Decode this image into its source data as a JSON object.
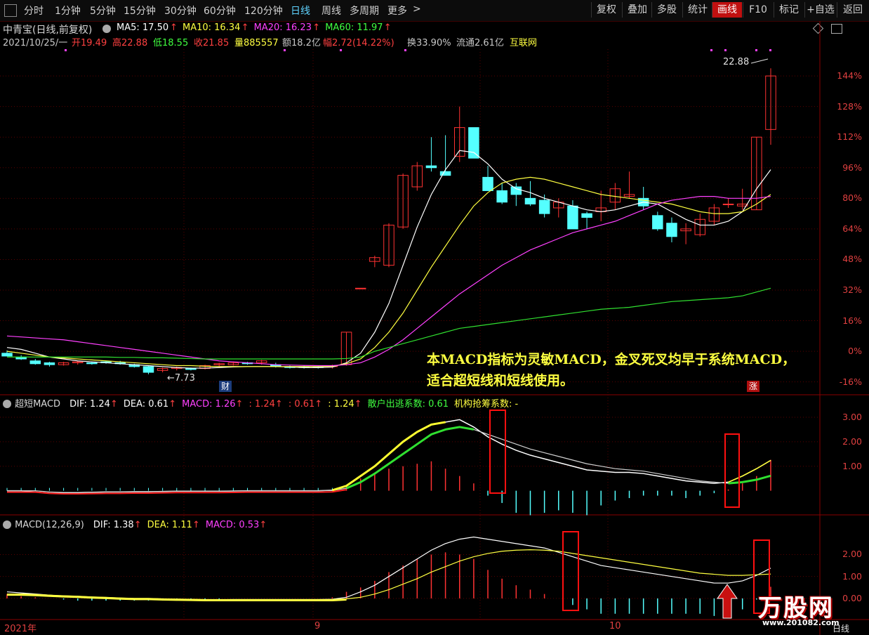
{
  "toolbar": {
    "periods": [
      "分时",
      "1分钟",
      "5分钟",
      "15分钟",
      "30分钟",
      "60分钟",
      "120分钟",
      "日线",
      "周线",
      "多周期",
      "更多"
    ],
    "active_period": "日线",
    "right_buttons": [
      "复权",
      "叠加",
      "多股",
      "统计",
      "画线",
      "F10",
      "标记",
      "+自选",
      "返回"
    ],
    "active_button": "画线"
  },
  "header": {
    "title": "中青宝(日线,前复权)",
    "ma": [
      {
        "label": "MA5: 17.50",
        "color": "#ffffff"
      },
      {
        "label": "MA10: 16.34",
        "color": "#ffff40"
      },
      {
        "label": "MA20: 16.23",
        "color": "#ff40ff"
      },
      {
        "label": "MA60: 11.97",
        "color": "#40ff40"
      }
    ],
    "info": [
      {
        "text": "2021/10/25/一",
        "color": "#c8c8c8"
      },
      {
        "text": "开19.49",
        "color": "#ff4040"
      },
      {
        "text": "高22.88",
        "color": "#ff4040"
      },
      {
        "text": "低18.55",
        "color": "#40ff40"
      },
      {
        "text": "收21.85",
        "color": "#ff4040"
      },
      {
        "text": "量885557",
        "color": "#ffff40"
      },
      {
        "text": "额18.2亿",
        "color": "#c8c8c8"
      },
      {
        "text": "幅2.72(14.22%)",
        "color": "#ff4040"
      },
      {
        "text": "换33.90%",
        "color": "#c8c8c8"
      },
      {
        "text": "流通2.61亿",
        "color": "#c8c8c8"
      },
      {
        "text": "互联网",
        "color": "#ffff40"
      }
    ]
  },
  "price_axis": [
    "144%",
    "128%",
    "112%",
    "96%",
    "80%",
    "64%",
    "48%",
    "32%",
    "16%",
    "0%",
    "-16%"
  ],
  "annotations": {
    "high_price": "22.88",
    "low_price": "7.73",
    "cai_tag": "财",
    "zhang_tag": "涨",
    "note_line1": "本MACD指标为灵敏MACD，金叉死叉均早于系统MACD，",
    "note_line2": "适合超短线和短线使用。"
  },
  "panel1": {
    "title": "超短MACD",
    "items": [
      {
        "text": "DIF: 1.24",
        "color": "#ffffff"
      },
      {
        "text": "DEA: 0.61",
        "color": "#ffffff"
      },
      {
        "text": "MACD: 1.26",
        "color": "#ff40ff"
      },
      {
        "text": ": 1.24",
        "color": "#ff4040"
      },
      {
        "text": ": 0.61",
        "color": "#ff4040"
      },
      {
        "text": ": 1.24",
        "color": "#ffff40"
      },
      {
        "text": "散户出逃系数: 0.61",
        "color": "#40ff40"
      },
      {
        "text": "机构抢筹系数: -",
        "color": "#ffff40"
      }
    ],
    "axis": [
      "3.00",
      "2.00",
      "1.00"
    ]
  },
  "panel2": {
    "title": "MACD(12,26,9)",
    "items": [
      {
        "text": "DIF: 1.38",
        "color": "#ffffff"
      },
      {
        "text": "DEA: 1.11",
        "color": "#ffff40"
      },
      {
        "text": "MACD: 0.53",
        "color": "#ff40ff"
      }
    ],
    "axis": [
      "2.00",
      "1.00",
      "0.00"
    ]
  },
  "date_axis": {
    "year_label": "2021年",
    "months": [
      "9",
      "10"
    ],
    "period_label": "日线"
  },
  "watermark": {
    "brand": "万股网",
    "url": "www.201082.com"
  },
  "chart_data": {
    "type": "candlestick",
    "title": "中青宝(日线,前复权)",
    "candles_ohlc_pct": [
      [
        -1,
        0.5,
        -2,
        -2.5
      ],
      [
        -3,
        -2,
        -4.5,
        -4
      ],
      [
        -5,
        -4,
        -7,
        -6.5
      ],
      [
        -6,
        -5.5,
        -8,
        -7
      ],
      [
        -7,
        -5.5,
        -7.5,
        -6
      ],
      [
        -6,
        -5,
        -7,
        -5.5
      ],
      [
        -6,
        -5.5,
        -7,
        -6.5
      ],
      [
        -5.5,
        -5,
        -6.5,
        -6
      ],
      [
        -6,
        -5,
        -7,
        -6.5
      ],
      [
        -7,
        -6.5,
        -8.5,
        -8
      ],
      [
        -8,
        -7.5,
        -12,
        -11
      ],
      [
        -10,
        -8.5,
        -11,
        -9
      ],
      [
        -9,
        -8,
        -10,
        -8.5
      ],
      [
        -9,
        -8.5,
        -10,
        -9.5
      ],
      [
        -9,
        -7,
        -9.5,
        -7.5
      ],
      [
        -7,
        -6,
        -8,
        -6.5
      ],
      [
        -7,
        -5.5,
        -7.5,
        -6
      ],
      [
        -6,
        -5.5,
        -7,
        -6.5
      ],
      [
        -6,
        -4.5,
        -7,
        -5
      ],
      [
        -7,
        -6,
        -8.5,
        -8
      ],
      [
        -8,
        -7.5,
        -9,
        -8.5
      ],
      [
        -8,
        -7.5,
        -9,
        -8.5
      ],
      [
        -8,
        -7.5,
        -9,
        -8.5
      ],
      [
        -8,
        -7,
        -9,
        -7.5
      ],
      [
        -7,
        10,
        -7.5,
        10
      ],
      [
        33,
        33,
        33,
        33
      ],
      [
        47,
        50,
        44,
        49
      ],
      [
        45,
        67,
        44,
        66
      ],
      [
        65,
        93,
        64,
        92
      ],
      [
        86,
        99,
        84,
        97
      ],
      [
        97,
        112,
        94,
        96
      ],
      [
        94,
        113,
        93,
        92
      ],
      [
        102,
        128,
        99,
        117
      ],
      [
        117,
        117,
        101,
        101
      ],
      [
        91,
        97,
        84,
        84
      ],
      [
        84,
        88,
        77,
        78
      ],
      [
        86,
        88,
        76,
        82
      ],
      [
        80,
        89,
        76,
        77
      ],
      [
        79,
        82,
        70,
        72
      ],
      [
        75,
        80,
        70,
        78
      ],
      [
        76,
        79,
        64,
        64
      ],
      [
        72,
        73,
        64,
        70
      ],
      [
        73,
        84,
        68,
        75
      ],
      [
        78,
        88,
        74,
        85
      ],
      [
        81,
        94,
        80,
        82
      ],
      [
        80,
        86,
        74,
        76
      ],
      [
        71,
        73,
        63,
        64
      ],
      [
        67,
        70,
        57,
        60
      ],
      [
        63,
        67,
        56,
        64
      ],
      [
        61,
        72,
        60,
        69
      ],
      [
        68,
        77,
        66,
        75
      ],
      [
        77,
        80,
        75,
        77
      ],
      [
        76,
        85,
        74,
        77
      ],
      [
        74,
        112,
        74,
        112
      ],
      [
        116,
        148,
        108,
        144
      ]
    ],
    "y_axis_unit": "%",
    "y_axis_ticks": [
      144,
      128,
      112,
      96,
      80,
      64,
      48,
      32,
      16,
      0,
      -16
    ],
    "ylim": [
      -22,
      158
    ],
    "x_labels": [
      "2021年",
      "9",
      "10"
    ],
    "ma_series": [
      {
        "name": "MA5",
        "values": [
          2,
          1,
          -1,
          -3,
          -4,
          -5,
          -5.5,
          -6,
          -6.5,
          -7,
          -7.5,
          -8,
          -8.5,
          -8.8,
          -8.8,
          -8.5,
          -8.2,
          -8,
          -8,
          -8,
          -8.2,
          -8.5,
          -8.5,
          -8.3,
          -6,
          -1,
          10,
          25,
          45,
          65,
          82,
          95,
          105,
          104,
          98,
          90,
          85,
          83,
          80,
          78,
          76,
          74,
          73,
          74,
          76,
          78,
          77,
          73,
          69,
          66,
          66,
          68,
          73,
          85,
          95
        ]
      },
      {
        "name": "MA10",
        "values": [
          0,
          -1,
          -2,
          -3,
          -3.5,
          -4,
          -4.5,
          -5,
          -5.5,
          -6,
          -6.5,
          -7,
          -7.5,
          -7.5,
          -7.8,
          -8,
          -8,
          -8,
          -8,
          -8,
          -8,
          -8,
          -8,
          -7.8,
          -6.5,
          -4,
          2,
          10,
          20,
          32,
          44,
          55,
          66,
          76,
          83,
          88,
          90,
          91,
          90,
          88,
          86,
          84,
          82,
          81,
          80,
          79,
          78,
          77,
          75,
          73,
          72,
          72,
          73,
          77,
          82
        ]
      },
      {
        "name": "MA20",
        "values": [
          8,
          7.5,
          7,
          6.5,
          6,
          5,
          4,
          3,
          2,
          1,
          0,
          -1,
          -2,
          -3,
          -4,
          -5,
          -5.5,
          -6,
          -6.5,
          -7,
          -7.2,
          -7.4,
          -7.5,
          -7.5,
          -7,
          -6,
          -3,
          1,
          6,
          12,
          18,
          24,
          30,
          35,
          40,
          45,
          49,
          53,
          56,
          59,
          62,
          64,
          66,
          68,
          71,
          74,
          77,
          79,
          80,
          81,
          81,
          80,
          80,
          80,
          81
        ]
      },
      {
        "name": "MA60",
        "values": [
          -3,
          -3,
          -3,
          -3,
          -3,
          -3,
          -3,
          -3,
          -3.2,
          -3.2,
          -3.4,
          -3.4,
          -3.6,
          -3.8,
          -4,
          -4,
          -4,
          -4,
          -4,
          -4,
          -4,
          -4,
          -4,
          -4,
          -3.8,
          -3,
          0,
          2,
          4,
          6,
          8,
          10,
          12,
          13,
          14,
          15,
          16,
          17,
          18,
          19,
          20,
          21,
          22,
          22.5,
          23,
          24,
          25,
          26,
          26.5,
          27,
          27.5,
          28,
          29,
          31,
          33
        ]
      }
    ],
    "macd_sensitive": {
      "dif": [
        0,
        0,
        -0.05,
        -0.1,
        -0.1,
        -0.08,
        -0.06,
        -0.05,
        -0.05,
        -0.04,
        -0.04,
        -0.03,
        -0.02,
        -0.02,
        -0.02,
        -0.02,
        -0.01,
        0,
        0,
        0,
        0,
        0,
        0,
        0.02,
        0.2,
        0.6,
        1,
        1.5,
        2,
        2.4,
        2.7,
        2.8,
        2.9,
        2.6,
        2.2,
        1.9,
        1.65,
        1.45,
        1.3,
        1.15,
        1.0,
        0.85,
        0.8,
        0.75,
        0.75,
        0.7,
        0.6,
        0.5,
        0.4,
        0.35,
        0.3,
        0.35,
        0.6,
        0.9,
        1.24
      ],
      "dea": [
        0,
        0,
        0,
        -0.05,
        -0.07,
        -0.07,
        -0.06,
        -0.05,
        -0.05,
        -0.04,
        -0.04,
        -0.03,
        -0.02,
        -0.02,
        -0.02,
        -0.02,
        -0.01,
        0,
        0,
        0,
        0,
        0,
        0,
        0.01,
        0.1,
        0.35,
        0.7,
        1.1,
        1.5,
        1.9,
        2.3,
        2.5,
        2.6,
        2.5,
        2.3,
        2.1,
        1.9,
        1.7,
        1.55,
        1.4,
        1.25,
        1.1,
        1.0,
        0.9,
        0.85,
        0.8,
        0.7,
        0.6,
        0.5,
        0.4,
        0.35,
        0.3,
        0.35,
        0.45,
        0.61
      ],
      "hist": [
        0.1,
        0.1,
        -0.05,
        -0.05,
        0,
        0,
        0,
        0,
        0,
        0,
        0,
        0,
        0,
        0,
        0,
        0,
        0,
        0,
        0,
        0,
        0,
        0,
        0,
        0,
        0.2,
        0.5,
        0.7,
        0.9,
        1,
        1.1,
        1.2,
        0.9,
        0.6,
        0.3,
        -0.2,
        -0.5,
        -0.9,
        -1.0,
        -0.9,
        -0.8,
        -0.9,
        -1.0,
        -0.6,
        -0.4,
        -0.3,
        -0.2,
        -0.2,
        -0.2,
        -0.3,
        -0.2,
        -0.1,
        0.05,
        0.3,
        0.6,
        1.26
      ]
    },
    "macd_standard": {
      "dif": [
        0.3,
        0.25,
        0.2,
        0.15,
        0.1,
        0.05,
        0.03,
        0,
        -0.02,
        -0.05,
        -0.05,
        -0.05,
        -0.06,
        -0.06,
        -0.06,
        -0.06,
        -0.05,
        -0.05,
        -0.05,
        -0.05,
        -0.05,
        -0.05,
        -0.05,
        -0.04,
        0.05,
        0.3,
        0.6,
        1.0,
        1.4,
        1.8,
        2.2,
        2.5,
        2.7,
        2.8,
        2.7,
        2.6,
        2.5,
        2.4,
        2.3,
        2.1,
        1.9,
        1.7,
        1.5,
        1.4,
        1.3,
        1.2,
        1.1,
        1.0,
        0.9,
        0.8,
        0.7,
        0.7,
        0.8,
        1.05,
        1.38
      ],
      "dea": [
        0.2,
        0.2,
        0.18,
        0.15,
        0.12,
        0.1,
        0.07,
        0.05,
        0.02,
        0,
        0,
        -0.02,
        -0.03,
        -0.04,
        -0.05,
        -0.05,
        -0.05,
        -0.05,
        -0.05,
        -0.05,
        -0.05,
        -0.05,
        -0.05,
        -0.05,
        -0.02,
        0.05,
        0.2,
        0.4,
        0.65,
        0.9,
        1.2,
        1.45,
        1.7,
        1.9,
        2.05,
        2.15,
        2.2,
        2.22,
        2.2,
        2.15,
        2.05,
        1.95,
        1.85,
        1.75,
        1.65,
        1.55,
        1.45,
        1.35,
        1.25,
        1.15,
        1.1,
        1.05,
        1.05,
        1.08,
        1.11
      ],
      "hist": [
        0.2,
        0.1,
        0.05,
        0,
        -0.05,
        -0.1,
        -0.1,
        -0.1,
        -0.1,
        -0.1,
        -0.1,
        -0.1,
        -0.1,
        -0.1,
        -0.05,
        -0.05,
        0,
        0,
        0,
        0,
        0,
        0,
        0,
        0.05,
        0.3,
        0.5,
        0.8,
        1.2,
        1.5,
        1.8,
        2.0,
        2.1,
        2.0,
        1.8,
        1.3,
        0.9,
        0.6,
        0.4,
        0.2,
        0,
        -0.3,
        -0.5,
        -0.7,
        -0.7,
        -0.7,
        -0.7,
        -0.7,
        -0.7,
        -0.7,
        -0.7,
        -0.8,
        -0.7,
        -0.5,
        -0.05,
        0.53
      ]
    }
  }
}
